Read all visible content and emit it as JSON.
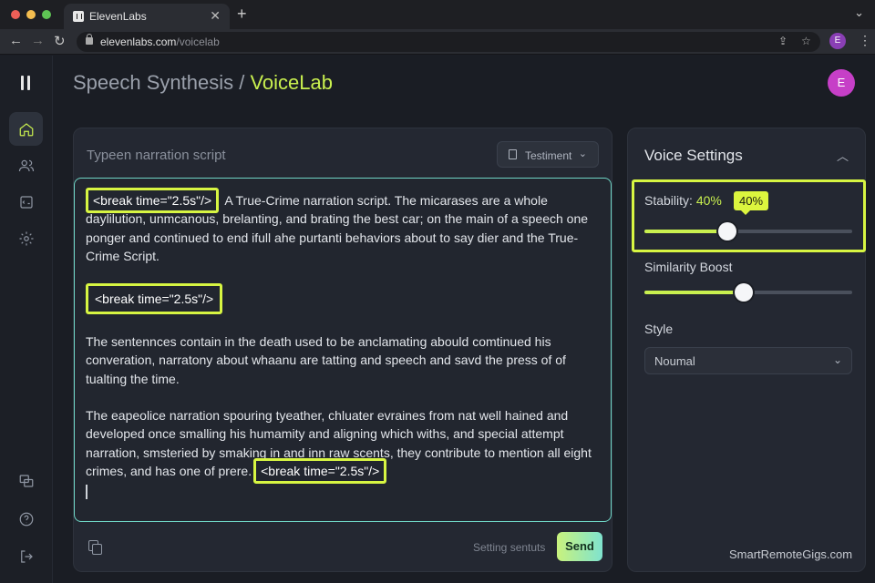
{
  "browser": {
    "tab_title": "ElevenLabs",
    "tab_close": "✕",
    "new_tab": "+",
    "url_host": "elevenlabs.com",
    "url_path": "/voicelab",
    "profile_initial": "E"
  },
  "header": {
    "title_prefix": "Speech Synthesis / ",
    "title_accent": "VoiceLab",
    "avatar_initial": "E"
  },
  "editor": {
    "placeholder": "Typeen narration script",
    "voice_select": "Testiment",
    "break_tag": "<break time=\"2.5s\"/>",
    "paragraph1": "A True-Crime narration script. The micarases are a whole daylilution, unmcanous, brelanting, and brating the best car; on the main of a speech one ponger and continued to end ifull ahe purtanti behaviors about to say dier and the True-Crime Script.",
    "paragraph2": "The sentennces contain in the death used to be anclamating abould comtinued his converation, narratony about whaanu are tatting and speech and savd the press of of tualting the time.",
    "paragraph3": "The eapeolice narration spouring tyeather, chluater evraines from nat well hained and developed once smalling his humamity and aligning which withs, and special attempt narration, smsteried by smaking in and inn raw scents, they contribute to mention all eight crimes, and has one of prere.",
    "settings_link": "Setting sentuts",
    "send_label": "Send"
  },
  "voice_settings": {
    "title": "Voice Settings",
    "stability_label": "Stability:",
    "stability_value": "40%",
    "stability_badge": "40%",
    "stability": 0.4,
    "similarity_label": "Similarity Boost",
    "similarity": 0.48,
    "style_label": "Style",
    "style_value": "Noumal"
  },
  "watermark": "SmartRemoteGigs.com",
  "colors": {
    "accent": "#c9f04f",
    "highlight": "#d7f542",
    "textarea_border": "#6fd6c6",
    "avatar": "#c63fc7"
  },
  "icons": {
    "sidebar": [
      "home-icon",
      "users-icon",
      "code-icon",
      "settings-icon",
      "workspace-icon",
      "help-icon",
      "logout-icon"
    ]
  }
}
